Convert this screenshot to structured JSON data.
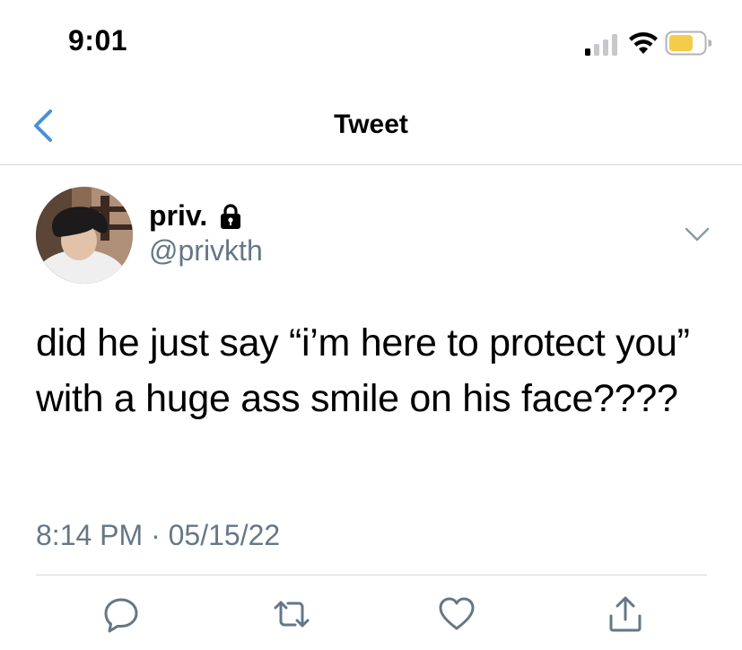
{
  "status_bar": {
    "time": "9:01",
    "icons": [
      "cellular-signal-icon",
      "wifi-icon",
      "battery-icon"
    ],
    "battery_color": "#f5cb4b"
  },
  "nav": {
    "back_icon": "chevron-left-icon",
    "title": "Tweet"
  },
  "tweet": {
    "author": {
      "display_name": "priv.",
      "protected_icon": "lock-icon",
      "handle": "@privkth"
    },
    "menu_icon": "chevron-down-icon",
    "text": "did he just say “i’m here to protect you” with a huge ass smile on his face????",
    "timestamp": "8:14 PM · 05/15/22"
  },
  "actions": [
    {
      "name": "reply",
      "icon": "reply-icon"
    },
    {
      "name": "retweet",
      "icon": "retweet-icon"
    },
    {
      "name": "like",
      "icon": "heart-icon"
    },
    {
      "name": "share",
      "icon": "share-icon"
    }
  ],
  "colors": {
    "accent": "#1da1f2",
    "back_arrow": "#4a90d9",
    "secondary_text": "#657786",
    "icon_gray": "#657786",
    "divider": "#d6d9dc"
  }
}
